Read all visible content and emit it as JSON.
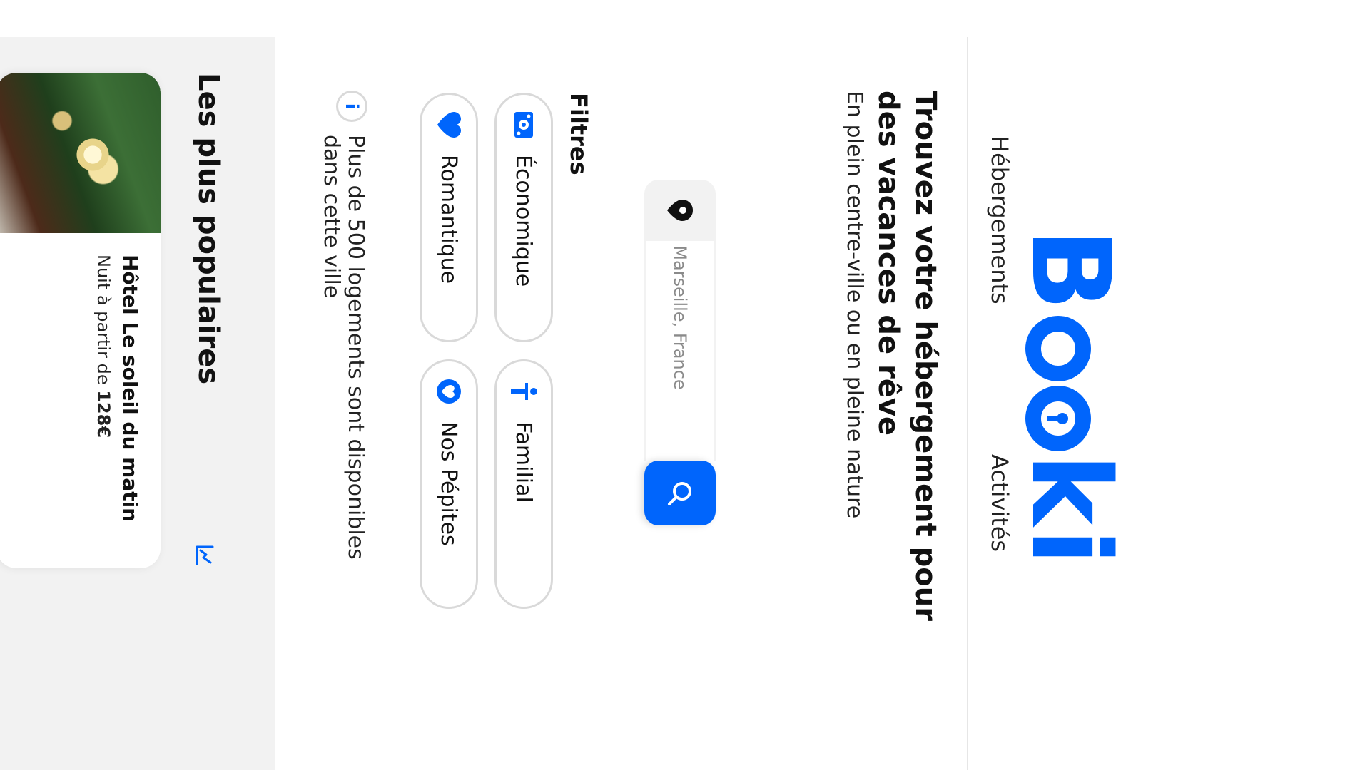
{
  "brand": {
    "logo_text": "Booki",
    "accent_color": "#0065FC"
  },
  "nav": {
    "items": [
      {
        "label": "Hébergements"
      },
      {
        "label": "Activités"
      }
    ]
  },
  "hero": {
    "title": "Trouvez votre hébergement pour des vacances de rêve",
    "subtitle": "En plein centre-ville ou en pleine nature"
  },
  "search": {
    "placeholder": "Marseille, France",
    "pin_icon": "location-pin-icon",
    "button_icon": "search-icon"
  },
  "filters": {
    "title": "Filtres",
    "chips": [
      {
        "label": "Économique",
        "icon": "money-icon"
      },
      {
        "label": "Familial",
        "icon": "child-icon"
      },
      {
        "label": "Romantique",
        "icon": "heart-icon"
      },
      {
        "label": "Nos Pépites",
        "icon": "gem-icon"
      }
    ]
  },
  "info": {
    "icon": "info-icon",
    "text": "Plus de 500 logements sont disponibles dans cette ville"
  },
  "popular": {
    "title": "Les plus populaires",
    "icon": "trending-icon",
    "cards": [
      {
        "name": "Hôtel Le soleil du matin",
        "price_prefix": "Nuit à partir de ",
        "price": "128€"
      }
    ]
  }
}
